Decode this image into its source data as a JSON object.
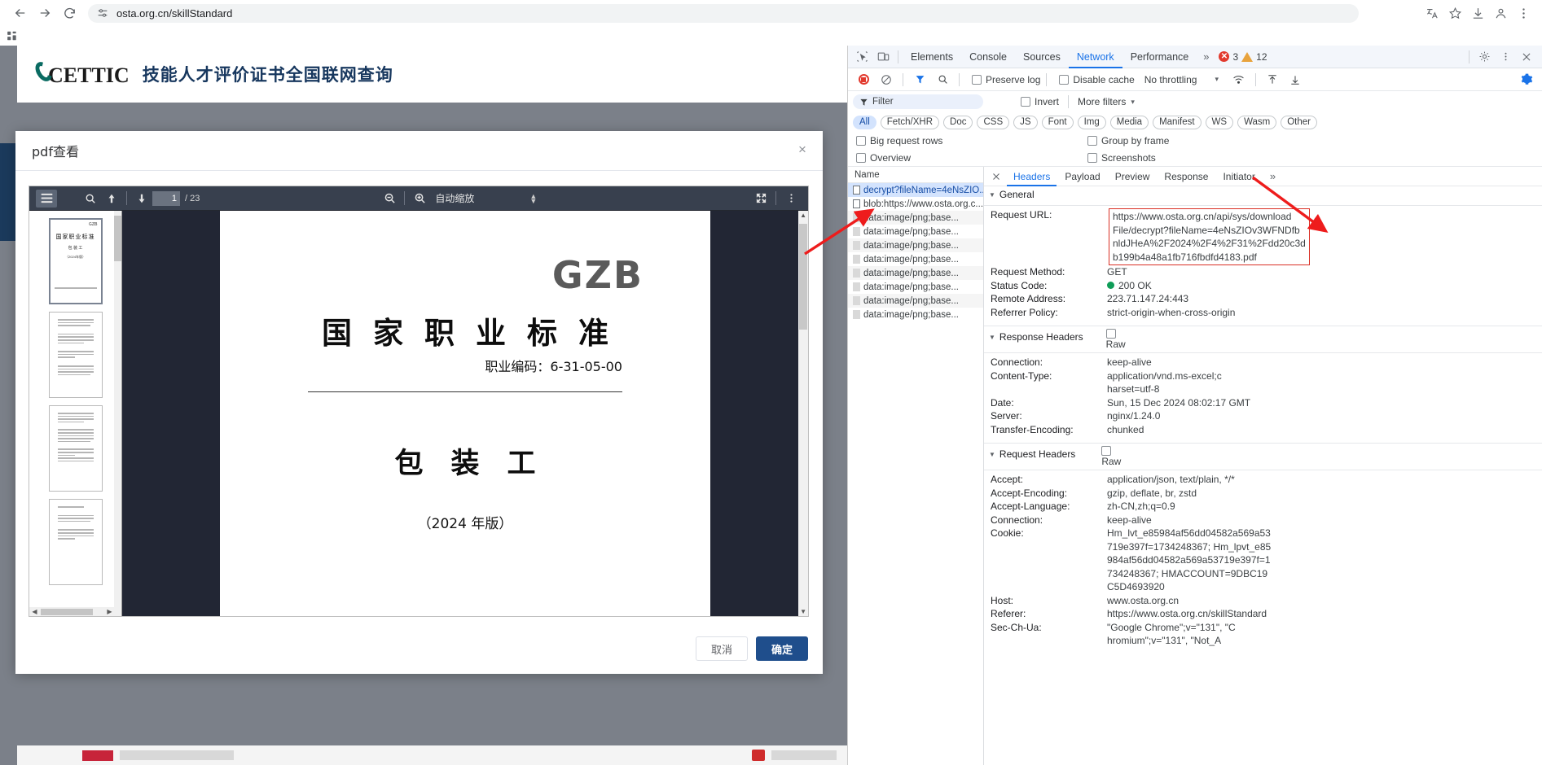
{
  "browser": {
    "url": "osta.org.cn/skillStandard",
    "back_icon": "back-arrow-icon",
    "forward_icon": "forward-arrow-icon",
    "reload_icon": "reload-icon",
    "site_settings_icon": "site-settings-icon",
    "translate_icon": "translate-icon",
    "bookmark_icon": "star-icon",
    "download_icon": "download-icon",
    "profile_icon": "profile-icon",
    "menu_icon": "three-dot-menu-icon",
    "apps_icon": "bookmark-apps-icon"
  },
  "site": {
    "logo_text": "CETTIC",
    "title_cn": "技能人才评价证书全国联网查询"
  },
  "modal": {
    "title": "pdf查看",
    "close_label": "×",
    "cancel_label": "取消",
    "confirm_label": "确定"
  },
  "pdf_viewer": {
    "sidebar_toggle_icon": "sidebar-toggle-icon",
    "find_icon": "search-icon",
    "prev_page_icon": "up-arrow-icon",
    "next_page_icon": "down-arrow-icon",
    "page_number": "1",
    "page_total": "/ 23",
    "zoom_out_icon": "zoom-out-icon",
    "zoom_in_icon": "zoom-in-icon",
    "zoom_level": "自动缩放",
    "presentation_icon": "presentation-mode-icon",
    "tools_icon": "secondary-toolbar-icon",
    "scroll_up_arrow": "▲",
    "scroll_down_arrow": "▼",
    "hscroll_left_arrow": "◀",
    "hscroll_right_arrow": "▶"
  },
  "pdf_page": {
    "watermark": "GZB",
    "heading": "国家职业标准",
    "occupation_code": "职业编码：6-31-05-00",
    "occupation_name": "包装工",
    "edition": "（2024 年版）"
  },
  "thumbnails": [
    {
      "label": "GZB",
      "kind": "cover"
    },
    {
      "label": "",
      "kind": "text"
    },
    {
      "label": "",
      "kind": "text"
    },
    {
      "label": "",
      "kind": "text"
    }
  ],
  "devtools": {
    "inspect_icon": "inspect-element-icon",
    "device_icon": "device-toolbar-icon",
    "tabs": [
      {
        "label": "Elements",
        "selected": false
      },
      {
        "label": "Console",
        "selected": false
      },
      {
        "label": "Sources",
        "selected": false
      },
      {
        "label": "Network",
        "selected": true
      },
      {
        "label": "Performance",
        "selected": false
      }
    ],
    "more_tabs_icon": "chevron-right-double-icon",
    "error_count": "3",
    "warning_count": "12",
    "settings_icon": "gear-icon",
    "kebab_icon": "three-dot-menu-icon",
    "close_icon": "close-icon",
    "toolbar": {
      "record_icon": "record-stop-icon",
      "clear_icon": "clear-network-icon",
      "filter_icon": "filter-funnel-icon",
      "search_icon": "search-icon",
      "preserve_log_label": "Preserve log",
      "disable_cache_label": "Disable cache",
      "throttling_label": "No throttling",
      "throttling_caret": "▾",
      "wifi_icon": "network-conditions-icon",
      "import_icon": "import-har-icon",
      "export_icon": "export-har-icon",
      "settings_gear_icon": "network-settings-gear-icon"
    },
    "filter": {
      "funnel_icon": "filter-funnel-icon",
      "placeholder": "Filter",
      "invert_label": "Invert",
      "more_filters_label": "More filters",
      "more_filters_caret": "▾"
    },
    "type_chips": [
      "All",
      "Fetch/XHR",
      "Doc",
      "CSS",
      "JS",
      "Font",
      "Img",
      "Media",
      "Manifest",
      "WS",
      "Wasm",
      "Other"
    ],
    "options": {
      "big_request_rows": "Big request rows",
      "group_by_frame": "Group by frame",
      "overview": "Overview",
      "screenshots": "Screenshots"
    },
    "name_column_header": "Name",
    "requests": [
      {
        "name": "decrypt?fileName=4eNsZIO...",
        "type": "doc",
        "selected": true
      },
      {
        "name": "blob:https://www.osta.org.c...",
        "type": "doc",
        "selected": false
      },
      {
        "name": "data:image/png;base...",
        "type": "img",
        "selected": false
      },
      {
        "name": "data:image/png;base...",
        "type": "img",
        "selected": false
      },
      {
        "name": "data:image/png;base...",
        "type": "img",
        "selected": false
      },
      {
        "name": "data:image/png;base...",
        "type": "img",
        "selected": false
      },
      {
        "name": "data:image/png;base...",
        "type": "img",
        "selected": false
      },
      {
        "name": "data:image/png;base...",
        "type": "img",
        "selected": false
      },
      {
        "name": "data:image/png;base...",
        "type": "img",
        "selected": false
      },
      {
        "name": "data:image/png;base...",
        "type": "img",
        "selected": false
      }
    ],
    "detail_tabs": [
      {
        "label": "Headers",
        "selected": true
      },
      {
        "label": "Payload",
        "selected": false
      },
      {
        "label": "Preview",
        "selected": false
      },
      {
        "label": "Response",
        "selected": false
      },
      {
        "label": "Initiator",
        "selected": false
      }
    ],
    "detail_more_icon": "chevron-right-double-icon",
    "general": {
      "section_label": "General",
      "request_url_label": "Request URL:",
      "request_url_lines": [
        "https://www.osta.org.cn/api/sys/download",
        "File/decrypt?fileName=4eNsZIOv3WFNDfb",
        "nldJHeA%2F2024%2F4%2F31%2Fdd20c3d",
        "b199b4a48a1fb716fbdfd4183.pdf"
      ],
      "request_method_label": "Request Method:",
      "request_method": "GET",
      "status_code_label": "Status Code:",
      "status_code": "200 OK",
      "remote_address_label": "Remote Address:",
      "remote_address": "223.71.147.24:443",
      "referrer_policy_label": "Referrer Policy:",
      "referrer_policy": "strict-origin-when-cross-origin"
    },
    "response_headers": {
      "section_label": "Response Headers",
      "raw_label": "Raw",
      "rows": [
        {
          "k": "Connection:",
          "v": "keep-alive"
        },
        {
          "k": "Content-Type:",
          "v": "application/vnd.ms-excel;charset=utf-8"
        },
        {
          "k": "Date:",
          "v": "Sun, 15 Dec 2024 08:02:17 GMT"
        },
        {
          "k": "Server:",
          "v": "nginx/1.24.0"
        },
        {
          "k": "Transfer-Encoding:",
          "v": "chunked"
        }
      ]
    },
    "request_headers": {
      "section_label": "Request Headers",
      "raw_label": "Raw",
      "rows": [
        {
          "k": "Accept:",
          "v": "application/json, text/plain, */*"
        },
        {
          "k": "Accept-Encoding:",
          "v": "gzip, deflate, br, zstd"
        },
        {
          "k": "Accept-Language:",
          "v": "zh-CN,zh;q=0.9"
        },
        {
          "k": "Connection:",
          "v": "keep-alive"
        },
        {
          "k": "Cookie:",
          "v": "Hm_lvt_e85984af56dd04582a569a53719e397f=1734248367; Hm_lpvt_e85984af56dd04582a569a53719e397f=1734248367; HMACCOUNT=9DBC19C5D4693920"
        },
        {
          "k": "Host:",
          "v": "www.osta.org.cn"
        },
        {
          "k": "Referer:",
          "v": "https://www.osta.org.cn/skillStandard"
        },
        {
          "k": "Sec-Ch-Ua:",
          "v": "\"Google Chrome\";v=\"131\", \"Chromium\";v=\"131\", \"Not_A"
        }
      ]
    }
  },
  "page_footer": {
    "note": ""
  }
}
